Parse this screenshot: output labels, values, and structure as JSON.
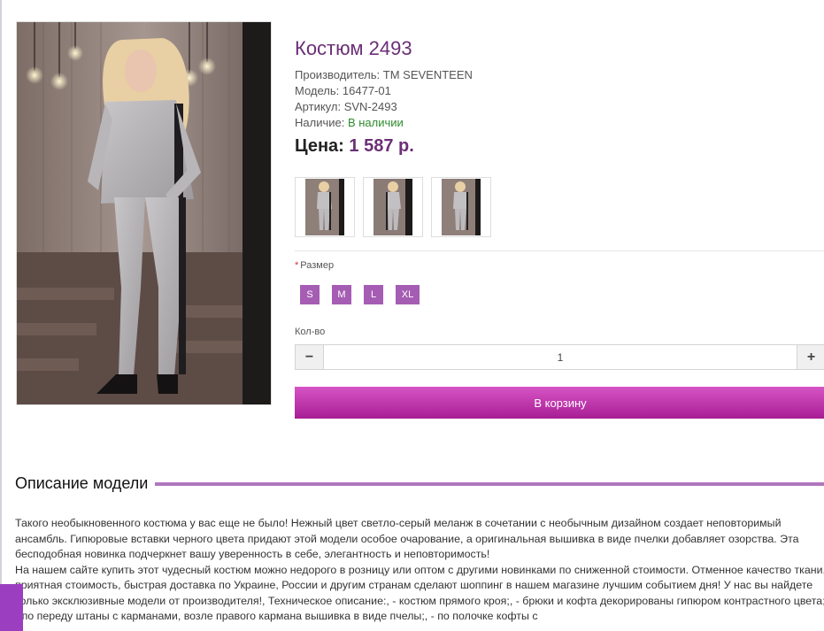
{
  "product": {
    "title": "Костюм 2493",
    "manufacturer_label": "Производитель:",
    "manufacturer_value": "ТМ SEVENTEEN",
    "model_label": "Модель:",
    "model_value": "16477-01",
    "sku_label": "Артикул:",
    "sku_value": "SVN-2493",
    "availability_label": "Наличие:",
    "availability_value": "В наличии",
    "price_label": "Цена:",
    "price_value": "1 587 р."
  },
  "options": {
    "size_required_mark": "*",
    "size_label": "Размер",
    "sizes": [
      "S",
      "M",
      "L",
      "XL"
    ]
  },
  "quantity": {
    "label": "Кол-во",
    "value": "1",
    "minus": "−",
    "plus": "+"
  },
  "cart": {
    "button_label": "В корзину"
  },
  "description": {
    "heading": "Описание модели",
    "paragraph1": "Такого необыкновенного костюма у вас еще не было! Нежный цвет светло-серый меланж в сочетании с необычным дизайном создает неповторимый ансамбль. Гипюровые вставки черного цвета придают этой модели особое очарование, а оригинальная вышивка в виде пчелки добавляет озорства. Эта бесподобная новинка подчеркнет вашу уверенность в себе, элегантность и неповторимость!",
    "paragraph2": "На нашем сайте купить этот чудесный костюм можно недорого в розницу или оптом с другими новинками по сниженной стоимости. Отменное качество ткани, приятная стоимость, быстрая доставка по Украине, России и другим странам сделают шоппинг в нашем магазине лучшим событием дня! У нас вы найдете только эксклюзивные модели от производителя!, Техническое описание:, - костюм прямого кроя;, - брюки и кофта декорированы гипюром контрастного цвета;, - по переду штаны с карманами, возле правого кармана вышивка в виде пчелы;, - по полочке кофты с"
  },
  "colors": {
    "accent": "#6b2f76",
    "size_button": "#a55db3",
    "cart_gradient_top": "#d654c6",
    "cart_gradient_bottom": "#a81e94",
    "in_stock": "#2e8b2e",
    "heading_rule": "#b077bd"
  }
}
